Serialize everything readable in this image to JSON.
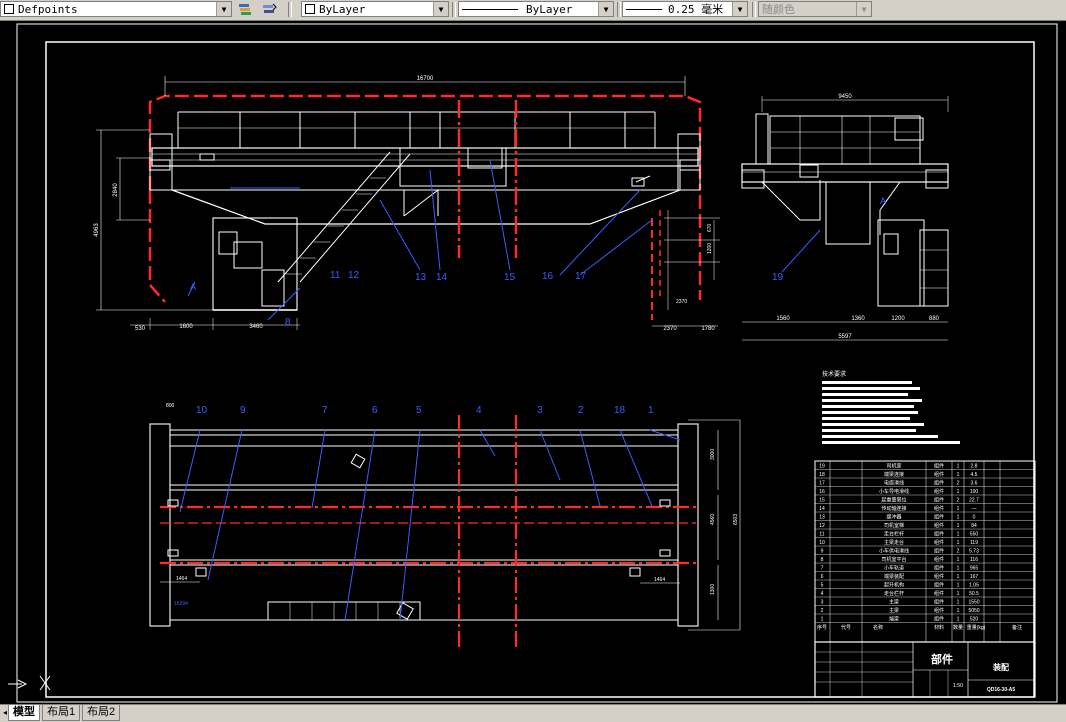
{
  "toolbar": {
    "layer": "Defpoints",
    "color": "ByLayer",
    "linetype": "ByLayer",
    "lineweight": "0.25 毫米",
    "plotstyle": "随颜色"
  },
  "drawing": {
    "dims": {
      "top_span": "16700",
      "side_span": "9450",
      "h_left_1": "4963",
      "h_left_2": "2840",
      "b1": "530",
      "b2": "1600",
      "b3": "3460",
      "b4": "2370",
      "b5": "1780",
      "b6": "880",
      "b7": "5597",
      "b8": "1560",
      "r1": "670",
      "r2": "2370",
      "r3": "1360",
      "r4": "1200",
      "p1": "3000",
      "p2": "4560",
      "p3": "1300",
      "p4": "1464",
      "p5": "15294",
      "p6": "1464",
      "p7": "6503",
      "p8": "800"
    },
    "callouts": [
      "1",
      "2",
      "3",
      "4",
      "5",
      "6",
      "7",
      "8",
      "9",
      "10",
      "11",
      "12",
      "13",
      "14",
      "15",
      "16",
      "17",
      "18",
      "19"
    ]
  },
  "notes": {
    "title": "技术要求"
  },
  "bom": {
    "rows": [
      {
        "no": "19",
        "name": "司机室",
        "mat": "组件",
        "qty": "1",
        "w": "2.8"
      },
      {
        "no": "18",
        "name": "端梁连接",
        "mat": "组件",
        "qty": "1",
        "w": "4.5"
      },
      {
        "no": "17",
        "name": "电缆滑线",
        "mat": "组件",
        "qty": "2",
        "w": "3.6"
      },
      {
        "no": "16",
        "name": "小车导电滑线",
        "mat": "组件",
        "qty": "1",
        "w": "100"
      },
      {
        "no": "15",
        "name": "起重量限位",
        "mat": "组件",
        "qty": "2",
        "w": "22.7"
      },
      {
        "no": "14",
        "name": "传动轴连接",
        "mat": "组件",
        "qty": "1",
        "w": "—"
      },
      {
        "no": "13",
        "name": "缓冲器",
        "mat": "组件",
        "qty": "1",
        "w": "0"
      },
      {
        "no": "12",
        "name": "司机室梯",
        "mat": "组件",
        "qty": "1",
        "w": "84"
      },
      {
        "no": "11",
        "name": "走台栏杆",
        "mat": "组件",
        "qty": "1",
        "w": "550"
      },
      {
        "no": "10",
        "name": "主梁走台",
        "mat": "组件",
        "qty": "1",
        "w": "119"
      },
      {
        "no": "9",
        "name": "小车供电滑线",
        "mat": "组件",
        "qty": "2",
        "w": "5.73"
      },
      {
        "no": "8",
        "name": "司机室平台",
        "mat": "组件",
        "qty": "1",
        "w": "116"
      },
      {
        "no": "7",
        "name": "小车轨道",
        "mat": "组件",
        "qty": "1",
        "w": "965"
      },
      {
        "no": "6",
        "name": "端梁装配",
        "mat": "组件",
        "qty": "1",
        "w": "167"
      },
      {
        "no": "5",
        "name": "起升机构",
        "mat": "组件",
        "qty": "1",
        "w": "1.05"
      },
      {
        "no": "4",
        "name": "走台栏杆",
        "mat": "组件",
        "qty": "1",
        "w": "50.5"
      },
      {
        "no": "3",
        "name": "主梁",
        "mat": "组件",
        "qty": "1",
        "w": "1550"
      },
      {
        "no": "2",
        "name": "主梁",
        "mat": "组件",
        "qty": "1",
        "w": "5050"
      },
      {
        "no": "1",
        "name": "端梁",
        "mat": "组件",
        "qty": "1",
        "w": "520"
      }
    ],
    "header": [
      "序号",
      "代号",
      "名称",
      "材料",
      "数量",
      "重量(kg)",
      "备注"
    ]
  },
  "titleblock": {
    "name": "部件",
    "code": "QD16-30-A5",
    "scale": "1:50",
    "company": "装配"
  },
  "tabs": {
    "model": "模型",
    "layout1": "布局1",
    "layout2": "布局2"
  }
}
